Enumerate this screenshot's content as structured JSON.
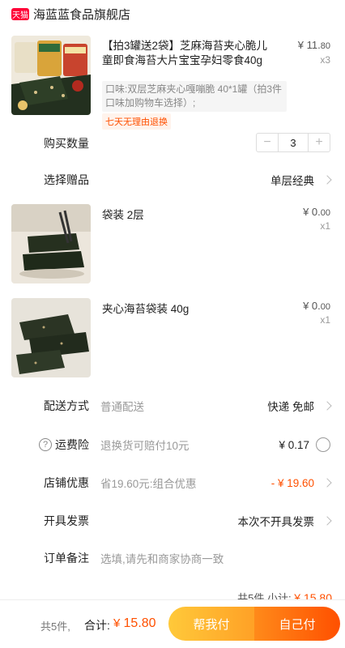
{
  "shop": {
    "badge": "天猫",
    "name": "海蓝蓝食品旗舰店"
  },
  "product": {
    "title": "【拍3罐送2袋】芝麻海苔夹心脆儿童即食海苔大片宝宝孕妇零食40g",
    "price_main": "¥ 11.",
    "price_cents": "80",
    "qty": "x3",
    "sku": "口味:双层芝麻夹心嘎嘣脆 40*1罐（拍3件口味加购物车选择）;",
    "tag": "七天无理由退换"
  },
  "purchase_qty": {
    "label": "购买数量",
    "minus": "−",
    "value": "3",
    "plus": "+"
  },
  "gift_select": {
    "label": "选择赠品",
    "value": "单层经典"
  },
  "gifts": [
    {
      "name": "袋装 2层",
      "price_main": "¥ 0.",
      "price_cents": "00",
      "qty": "x1"
    },
    {
      "name": "夹心海苔袋装 40g",
      "price_main": "¥ 0.",
      "price_cents": "00",
      "qty": "x1"
    }
  ],
  "delivery": {
    "label": "配送方式",
    "mid": "普通配送",
    "value": "快递 免邮"
  },
  "insurance": {
    "help": "?",
    "label": "运费险",
    "mid": "退换货可赔付10元",
    "value": "¥ 0.17"
  },
  "shop_discount": {
    "label": "店铺优惠",
    "mid": "省19.60元:组合优惠",
    "value": "- ¥ 19.60",
    "color": "#ff5000"
  },
  "invoice": {
    "label": "开具发票",
    "value": "本次不开具发票"
  },
  "remark": {
    "label": "订单备注",
    "placeholder": "选填,请先和商家协商一致"
  },
  "subtotal": {
    "count": "共5件",
    "label": "小计:",
    "amount": "¥ 15.80"
  },
  "bottom": {
    "count": "共5件,",
    "total_label": "合计:",
    "total_currency": "¥ ",
    "total_amount": "15.80",
    "pay_friend": "帮我付",
    "pay_self": "自己付"
  }
}
